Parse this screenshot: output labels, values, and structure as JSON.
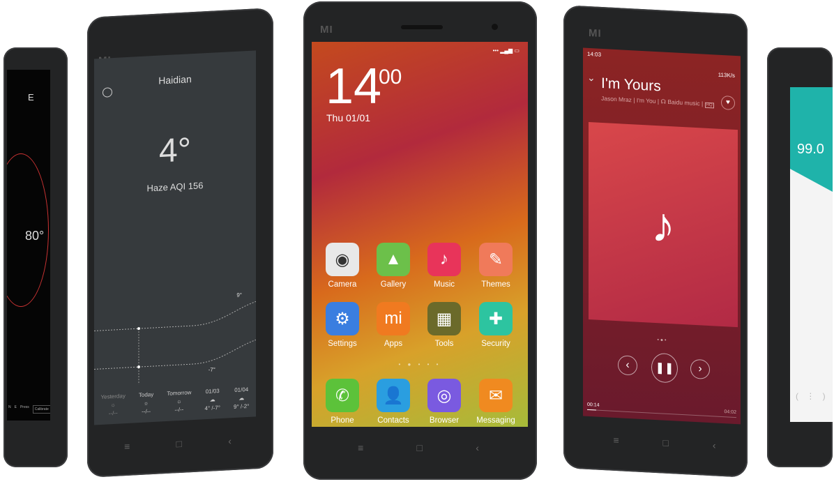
{
  "brand_logo": "MI",
  "compass_phone": {
    "heading": "E",
    "degrees": "80°",
    "footer": [
      "N",
      "E",
      "Press",
      "Calibrate"
    ]
  },
  "weather_phone": {
    "city": "Haidian",
    "temperature": "4°",
    "condition": "Haze  AQI 156",
    "high_label": "9°",
    "low_label": "-7°",
    "forecast": [
      {
        "day": "Yesterday",
        "temps": "--/--"
      },
      {
        "day": "Today",
        "temps": "--/--"
      },
      {
        "day": "Tomorrow",
        "temps": "--/--"
      },
      {
        "day": "01/03",
        "temps": "4° /-7°"
      },
      {
        "day": "01/04",
        "temps": "9° /-2°"
      }
    ]
  },
  "home_phone": {
    "hour": "14",
    "minute": "00",
    "date": "Thu 01/01",
    "apps": [
      {
        "label": "Camera",
        "icon": "camera-icon",
        "color": "#e8e8e8"
      },
      {
        "label": "Gallery",
        "icon": "gallery-icon",
        "color": "#6cc04a"
      },
      {
        "label": "Music",
        "icon": "music-icon",
        "color": "#e8345a"
      },
      {
        "label": "Themes",
        "icon": "themes-icon",
        "color": "#f07a5a"
      },
      {
        "label": "Settings",
        "icon": "gear-icon",
        "color": "#3a7ee0"
      },
      {
        "label": "Apps",
        "icon": "mi-icon",
        "color": "#f07a20"
      },
      {
        "label": "Tools",
        "icon": "folder-icon",
        "color": "#6b6a2a"
      },
      {
        "label": "Security",
        "icon": "shield-icon",
        "color": "#2dc4a0"
      },
      {
        "label": "Phone",
        "icon": "phone-icon",
        "color": "#5cc23a"
      },
      {
        "label": "Contacts",
        "icon": "contacts-icon",
        "color": "#2a9ee0"
      },
      {
        "label": "Browser",
        "icon": "browser-icon",
        "color": "#7a5ae0"
      },
      {
        "label": "Messaging",
        "icon": "message-icon",
        "color": "#f08a20"
      }
    ]
  },
  "music_phone": {
    "time": "14:03",
    "network": "113K/s",
    "title": "I'm Yours",
    "artist": "Jason Mraz",
    "album": "I'm You",
    "source": "Baidu music",
    "quality": "HQ",
    "elapsed": "00:14",
    "duration": "04:02",
    "progress": 0.06
  },
  "radio_phone": {
    "frequency": "99.0"
  }
}
